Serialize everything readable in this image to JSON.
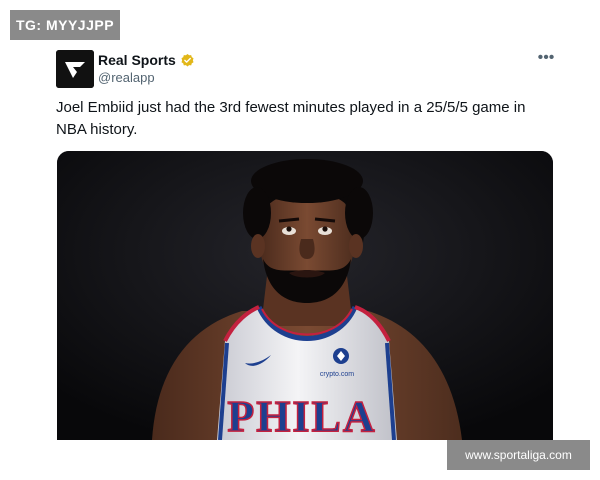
{
  "overlay": {
    "tg_label": "TG: MYYJJPP",
    "site_watermark": "www.sportaliga.com"
  },
  "tweet": {
    "author": {
      "display_name": "Real Sports",
      "handle": "@realapp",
      "verified": true,
      "avatar_icon": "real-sports-logo"
    },
    "more_icon": "more-horizontal-icon",
    "text": "Joel Embiid just had the 3rd fewest minutes played in a 25/5/5 game in NBA history.",
    "media": {
      "jersey_text": "PHILA",
      "sponsor_text": "crypto.com",
      "colors": {
        "background": "#0d0d10",
        "jersey": "#f2f2f4",
        "accent_red": "#c4213f",
        "accent_blue": "#1d3f8f"
      }
    }
  },
  "colors": {
    "text_primary": "#0f1419",
    "text_secondary": "#536471",
    "verified_gold": "#e2b719",
    "overlay_gray": "#8a8a8a"
  }
}
